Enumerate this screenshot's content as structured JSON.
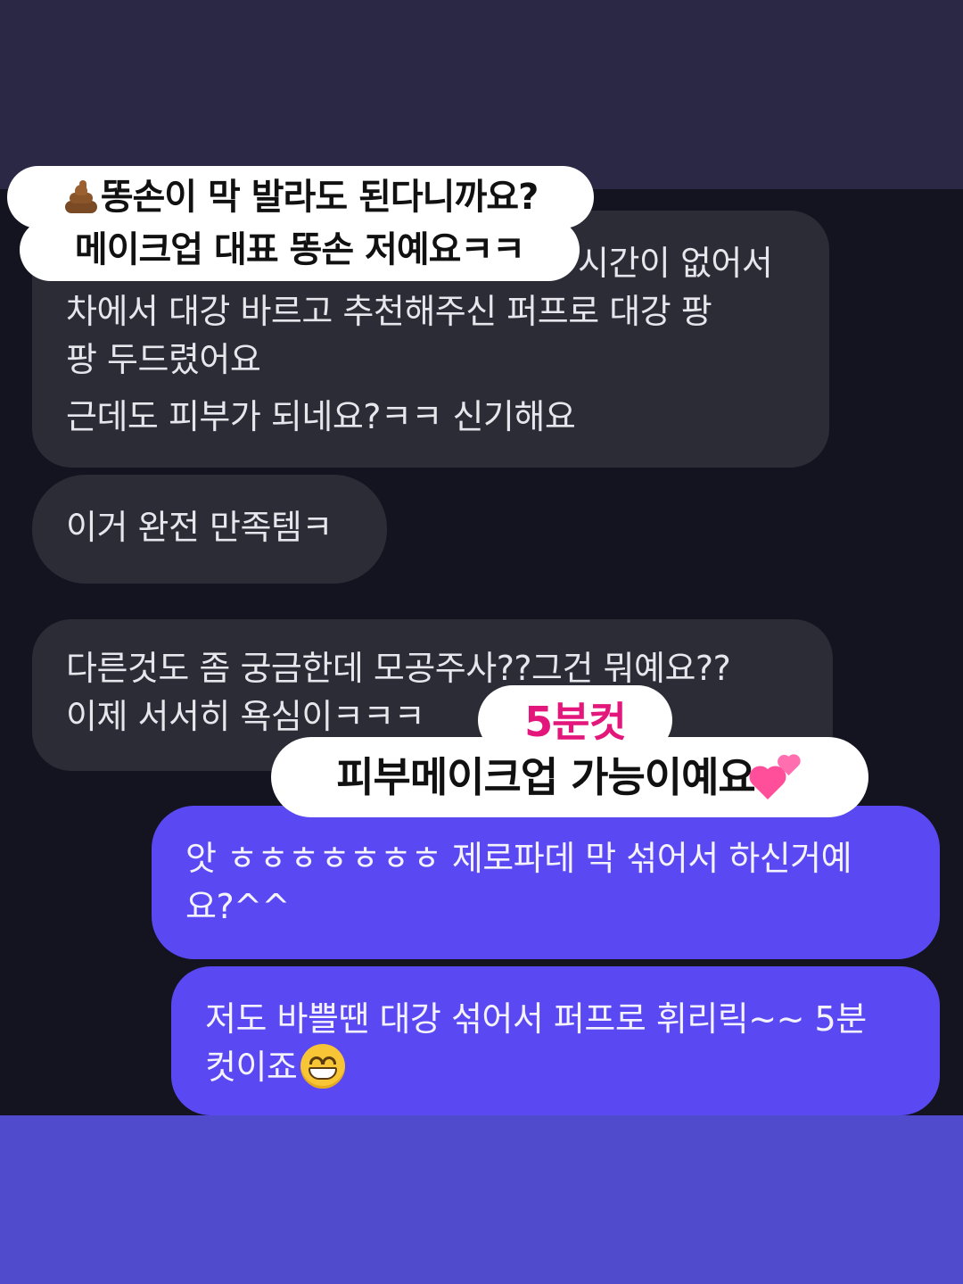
{
  "messages": [
    {
      "id": "received-1",
      "direction": "received",
      "lines": [
        "시간이 없어서",
        "차에서 대강 바르고 추천해주신 퍼프로 대강 팡",
        "팡 두드렸어요",
        "근데도 피부가 되네요?ㅋㅋ 신기해요"
      ]
    },
    {
      "id": "received-2",
      "direction": "received",
      "lines": [
        "이거 완전 만족템ㅋ"
      ]
    },
    {
      "id": "received-3",
      "direction": "received",
      "lines": [
        "다른것도 좀 궁금한데 모공주사??그건 뭐예요??",
        "이제 서서히 욕심이ㅋㅋㅋ"
      ]
    },
    {
      "id": "sent-1",
      "direction": "sent",
      "lines": [
        "앗 ㅎㅎㅎㅎㅎㅎㅎ 제로파데 막 섞어서 하신거예",
        "요?^^"
      ]
    },
    {
      "id": "sent-2",
      "direction": "sent",
      "lines": [
        "저도 바쁠땐 대강 섞어서 퍼프로 휘리릭~~ 5분",
        "컷이죠"
      ],
      "emoji": "grinning-face-icon"
    }
  ],
  "stickers": {
    "top_line1": "똥손이 막 발라도 된다니까요?",
    "top_line1_emoji": "poo-icon",
    "top_line2": "메이크업 대표 똥손 저예요ㅋㅋ",
    "mid_highlight": "5분컷",
    "mid_highlight_color": "#e3177b",
    "mid_line": "피부메이크업 가능이예요",
    "mid_line_emoji": "two-hearts-icon"
  },
  "colors": {
    "top_band": "#2b2845",
    "chat_background": "#13141f",
    "received_bubble": "#2b2c35",
    "sent_bubble": "#5a49f2",
    "bottom_band": "#4f4bcc"
  }
}
